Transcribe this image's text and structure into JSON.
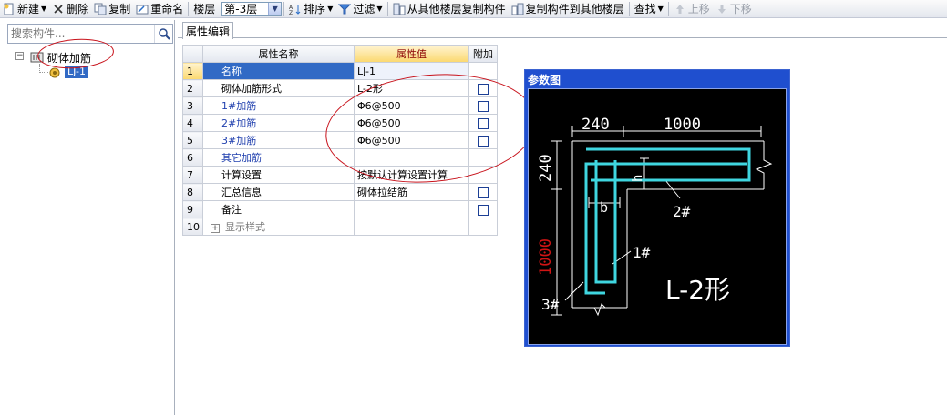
{
  "toolbar": {
    "new_label": "新建",
    "delete_label": "删除",
    "copy_label": "复制",
    "rename_label": "重命名",
    "floor_label": "楼层",
    "floor_value": "第-3层",
    "sort_label": "排序",
    "filter_label": "过滤",
    "copy_from_floor_label": "从其他楼层复制构件",
    "copy_to_floor_label": "复制构件到其他楼层",
    "find_label": "查找",
    "move_up_label": "上移",
    "move_down_label": "下移"
  },
  "left_panel": {
    "search_placeholder": "搜索构件...",
    "tree": {
      "root_label": "砌体加筋",
      "root_expander": "−",
      "child_label": "LJ-1"
    }
  },
  "right_panel": {
    "tab_label": "属性编辑",
    "grid": {
      "headers": [
        "属性名称",
        "属性值",
        "附加"
      ],
      "rows": [
        {
          "num": "1",
          "name": "名称",
          "value": "LJ-1",
          "checkbox": false
        },
        {
          "num": "2",
          "name": "砌体加筋形式",
          "value": "L-2形",
          "checkbox": true
        },
        {
          "num": "3",
          "name": "1#加筋",
          "value": "Φ6@500",
          "checkbox": true
        },
        {
          "num": "4",
          "name": "2#加筋",
          "value": "Φ6@500",
          "checkbox": true
        },
        {
          "num": "5",
          "name": "3#加筋",
          "value": "Φ6@500",
          "checkbox": true
        },
        {
          "num": "6",
          "name": "其它加筋",
          "value": "",
          "checkbox": false
        },
        {
          "num": "7",
          "name": "计算设置",
          "value": "按默认计算设置计算",
          "checkbox": false
        },
        {
          "num": "8",
          "name": "汇总信息",
          "value": "砌体拉结筋",
          "checkbox": true
        },
        {
          "num": "9",
          "name": "备注",
          "value": "",
          "checkbox": true
        },
        {
          "num": "10",
          "name": "显示样式",
          "value": "",
          "checkbox": false,
          "expander": "+"
        }
      ]
    }
  },
  "param_window": {
    "title": "参数图",
    "dim_top_left": "240",
    "dim_top_right": "1000",
    "dim_left_top": "240",
    "dim_left_bottom": "1000",
    "label_h": "h",
    "label_b": "b",
    "label_bar2": "2#",
    "label_bar1": "1#",
    "label_bar3": "3#",
    "shape_label": "L-2形"
  },
  "colors": {
    "rebar": "#3fd6e0",
    "dim_red": "#d01414",
    "annotation_oval": "#c8121b",
    "selection": "#316ac5",
    "header_highlight": "#fbd86e"
  }
}
